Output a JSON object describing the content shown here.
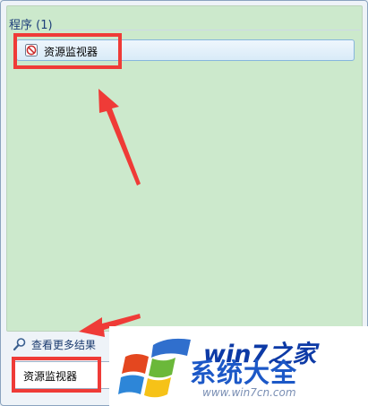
{
  "results": {
    "section_title": "程序 (1)",
    "items": [
      {
        "label": "资源监视器",
        "icon": "resource-monitor-icon"
      }
    ]
  },
  "footer": {
    "see_more_label": "查看更多结果",
    "search_value": "资源监视器"
  },
  "watermark": {
    "top_text": "win7之家",
    "cn_text": "系统大全",
    "url": "www.win7cn.com"
  },
  "colors": {
    "highlight": "#ef3b37",
    "results_bg": "#cce9cc",
    "title_color": "#1e3f7a"
  }
}
